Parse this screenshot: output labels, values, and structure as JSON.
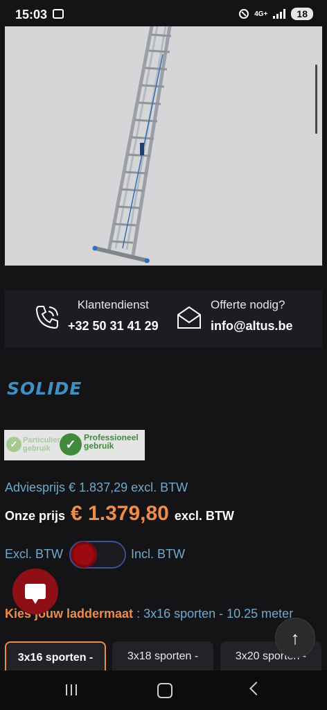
{
  "status": {
    "time": "15:03",
    "network": "4G+",
    "battery": "18"
  },
  "contact": {
    "service_label": "Klantendienst",
    "phone": "+32 50 31 41 29",
    "quote_label": "Offerte nodig?",
    "email": "info@altus.be"
  },
  "brand": {
    "logo_text": "SOLIDE",
    "color": "#3f8fc3"
  },
  "usage": {
    "private": "Particulier gebruik",
    "professional": "Professioneel gebruik"
  },
  "pricing": {
    "advice": "Adviesprijs € 1.837,29 excl. BTW",
    "our_price_label": "Onze prijs",
    "amount": "€ 1.379,80",
    "excl": "excl. BTW"
  },
  "vat_toggle": {
    "left_label": "Excl. BTW",
    "right_label": "Incl. BTW",
    "state": "excl"
  },
  "size": {
    "label": "Kies jouw laddermaat",
    "selected": " : 3x16 sporten - 10.25 meter"
  },
  "options": [
    {
      "label": "3x16 sporten -"
    },
    {
      "label": "3x18 sporten -"
    },
    {
      "label": "3x20 sporten -"
    }
  ],
  "colors": {
    "accent_orange": "#f08c4a",
    "link_blue": "#6fa9cf",
    "fab_red": "#8e1016"
  }
}
